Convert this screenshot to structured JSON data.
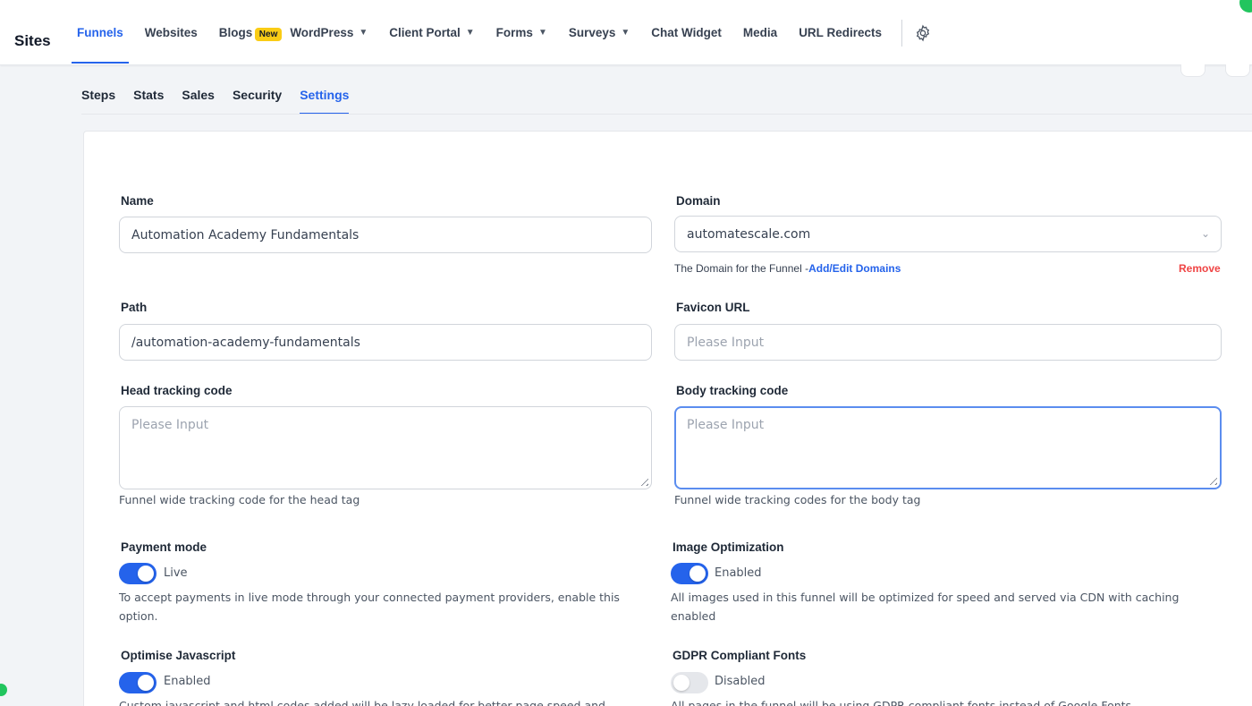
{
  "app": {
    "title": "Sites"
  },
  "nav": {
    "funnels": "Funnels",
    "websites": "Websites",
    "blogs": "Blogs",
    "blogs_badge": "New",
    "wordpress": "WordPress",
    "client_portal": "Client Portal",
    "forms": "Forms",
    "surveys": "Surveys",
    "chat_widget": "Chat Widget",
    "media": "Media",
    "url_redirects": "URL Redirects",
    "active": "Funnels"
  },
  "subtabs": {
    "steps": "Steps",
    "stats": "Stats",
    "sales": "Sales",
    "security": "Security",
    "settings": "Settings",
    "active": "Settings"
  },
  "form": {
    "name_label": "Name",
    "name_value": "Automation Academy Fundamentals",
    "domain_label": "Domain",
    "domain_value": "automatescale.com",
    "domain_help": "The Domain for the Funnel -",
    "domain_link": "Add/Edit Domains",
    "domain_remove": "Remove",
    "path_label": "Path",
    "path_value": "/automation-academy-fundamentals",
    "favicon_label": "Favicon URL",
    "favicon_placeholder": "Please Input",
    "head_label": "Head tracking code",
    "head_placeholder": "Please Input",
    "head_help": "Funnel wide tracking code for the head tag",
    "body_label": "Body tracking code",
    "body_placeholder": "Please Input",
    "body_help": "Funnel wide tracking codes for the body tag",
    "payment_label": "Payment mode",
    "payment_state": "Live",
    "payment_on": true,
    "payment_help": "To accept payments in live mode through your connected payment providers, enable this option.",
    "image_label": "Image Optimization",
    "image_state": "Enabled",
    "image_on": true,
    "image_help": "All images used in this funnel will be optimized for speed and served via CDN with caching enabled",
    "js_label": "Optimise Javascript",
    "js_state": "Enabled",
    "js_on": true,
    "js_help": "Custom javascript and html codes added will be lazy loaded for better page speed and",
    "gdpr_label": "GDPR Compliant Fonts",
    "gdpr_state": "Disabled",
    "gdpr_on": false,
    "gdpr_help": "All pages in the funnel will be using GDPR compliant fonts instead of Google Fonts"
  },
  "icons": {
    "settings": "gear-icon",
    "dropdown": "chevron-down-icon"
  },
  "colors": {
    "accent": "#2563eb",
    "badge": "#facc15",
    "danger": "#ef4444",
    "status_dot": "#22c55e"
  }
}
